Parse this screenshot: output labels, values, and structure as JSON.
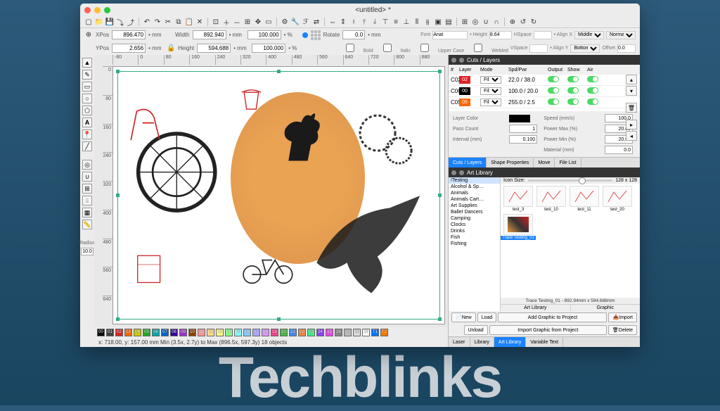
{
  "window": {
    "title": "<untitled> *"
  },
  "watermark": "Techblinks",
  "position": {
    "x_label": "XPos",
    "x_value": "896.470",
    "x_unit": "• mm",
    "y_label": "YPos",
    "y_value": "2.656",
    "y_unit": "• mm",
    "w_label": "Width",
    "w_value": "892.940",
    "w_unit": "• mm",
    "w_pct": "100.000",
    "pct_unit": "• %",
    "h_label": "Height",
    "h_value": "594.688",
    "h_unit": "• mm",
    "h_pct": "100.000",
    "rotate_label": "Rotate",
    "rotate_value": "0.0",
    "rotate_unit": "• mm"
  },
  "font_row": {
    "font_label": "Font",
    "font_value": "Arial",
    "height_label": "• Height",
    "height_value": "8.64",
    "height_unit": "• mm",
    "bold": "Bold",
    "italic": "Italic",
    "upper": "Upper Case",
    "welded": "Welded",
    "hspace_label": "HSpace",
    "vspace_label": "VSpace",
    "align_x": "• Align X",
    "align_x_val": "Middle",
    "align_y": "• Align Y",
    "align_y_val": "Bottom",
    "normal": "Normal",
    "offset": "Offset",
    "offset_val": "0.0"
  },
  "ruler_h": [
    "-80",
    "0",
    "80",
    "160",
    "240",
    "320",
    "400",
    "480",
    "560",
    "640",
    "720",
    "800",
    "880"
  ],
  "ruler_v": [
    "0",
    "80",
    "160",
    "240",
    "320",
    "400",
    "480",
    "560",
    "640"
  ],
  "tools_left": {
    "radius_label": "Radius",
    "radius_value": "10.0"
  },
  "color_strip": [
    "00",
    "01",
    "02",
    "03",
    "04",
    "05",
    "06",
    "07",
    "08",
    "09",
    "10",
    "11",
    "12",
    "13",
    "14",
    "15",
    "16",
    "17",
    "18",
    "19",
    "20",
    "21",
    "22",
    "23",
    "24",
    "25",
    "26",
    "27",
    "28",
    "29",
    "T1",
    "T2"
  ],
  "palette_colors": [
    "#000",
    "#444",
    "#d22",
    "#f60",
    "#cc0",
    "#2a2",
    "#0aa",
    "#06c",
    "#309",
    "#93c",
    "#840",
    "#f99",
    "#fd8",
    "#ff8",
    "#8f8",
    "#8ff",
    "#8cf",
    "#aaf",
    "#d9f",
    "#e48",
    "#4b4",
    "#48e",
    "#e84",
    "#4e8",
    "#84e",
    "#e4e",
    "#888",
    "#bbb",
    "#ddd",
    "#fff",
    "#07f",
    "#f70"
  ],
  "status_bar": "x: 718.00, y: 157.00 mm   Min (3.5x, 2.7y) to Max (896.5x, 597.3y)   18 objects",
  "cuts_panel": {
    "title": "Cuts / Layers",
    "header": {
      "num": "#",
      "layer": "Layer",
      "mode": "Mode",
      "spd": "Spd/Pwr",
      "output": "Output",
      "show": "Show",
      "air": "Air"
    },
    "rows": [
      {
        "id": "C02",
        "layer": "02",
        "color": "#d22",
        "mode": "Fill",
        "spd": "22.0 / 38.0"
      },
      {
        "id": "C00",
        "layer": "00",
        "color": "#000",
        "mode": "Fill",
        "spd": "100.0 / 20.0"
      },
      {
        "id": "C05",
        "layer": "05",
        "color": "#f60",
        "mode": "Fill",
        "spd": "255.0 / 2.5"
      }
    ],
    "props": {
      "layer_color": "Layer Color",
      "speed": "Speed (mm/s)",
      "speed_v": "100.0",
      "pass_count": "Pass Count",
      "pass_v": "1",
      "power_max": "Power Max (%)",
      "pmax_v": "20.00",
      "interval": "Interval (mm)",
      "int_v": "0.100",
      "power_min": "Power Min (%)",
      "pmin_v": "20.00",
      "material": "Material (mm)",
      "mat_v": "0.0"
    },
    "tabs": [
      "Cuts / Layers",
      "Shape Properties",
      "Move",
      "File List"
    ]
  },
  "art_library": {
    "title": "Art Library",
    "categories": [
      "!Testing",
      "Alcohol & Sp…",
      "Animals",
      "Animals Cart…",
      "Art Supplies",
      "Ballet Dancers",
      "Camping",
      "Clocks",
      "Drinks",
      "Fish",
      "Fishing"
    ],
    "icon_size_label": "Icon Size:",
    "icon_size_value": "128 x 128",
    "thumbs": [
      {
        "name": "test_3"
      },
      {
        "name": "test_10"
      },
      {
        "name": "test_11"
      },
      {
        "name": "test_20"
      },
      {
        "name": "Trace Testing_01",
        "selected": true
      }
    ],
    "selected_info": "Trace Testing_01 - 892.94mm x 594.688mm",
    "tab_label_lib": "Art Library",
    "tab_label_graphic": "Graphic",
    "buttons": {
      "new": "New",
      "load": "Load",
      "unload": "Unload",
      "add": "Add Graphic to Project",
      "import_g": "Import Graphic from Project",
      "import": "Import",
      "delete": "Delete"
    },
    "bottom_tabs": [
      "Laser",
      "Library",
      "Art Library",
      "Variable Text"
    ]
  }
}
